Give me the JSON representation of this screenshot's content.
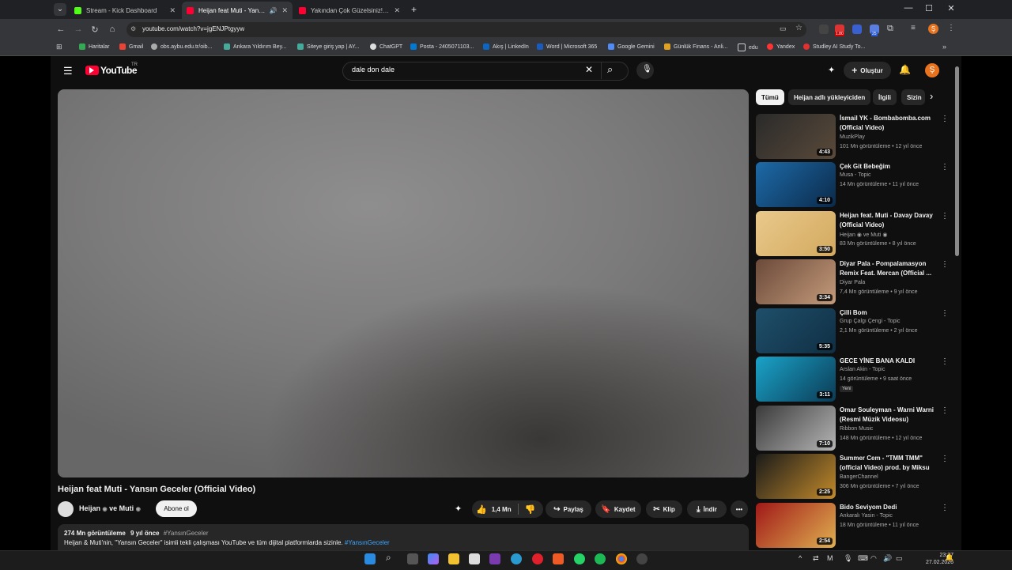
{
  "browser": {
    "tabs": [
      {
        "title": "Stream - Kick Dashboard",
        "color": "#53fc18"
      },
      {
        "title": "Heijan feat Muti - Yansın Ge",
        "color": "#ff0033"
      },
      {
        "title": "Yakından Çok Güzelsiniz! | Mar",
        "color": "#ff0033"
      }
    ],
    "new_tab": "+",
    "url": "youtube.com/watch?v=jgENJPtgyyw",
    "bookmarks": [
      "Haritalar",
      "Gmail",
      "obs.aybu.edu.tr/oib...",
      "Ankara Yıldırım Bey...",
      "Siteye giriş yap | AY...",
      "ChatGPT",
      "Posta - 2405071103...",
      "Akış | LinkedIn",
      "Word | Microsoft 365",
      "Google Gemini",
      "Günlük Finans - Anli...",
      "edu",
      "Yandex",
      "Studley AI Study To..."
    ],
    "badge": "1.80",
    "badge2": "25",
    "profile": "Ş"
  },
  "youtube": {
    "logo": "YouTube",
    "region": "TR",
    "search_value": "dale don dale",
    "create_label": "Oluştur",
    "avatar": "Ş",
    "video": {
      "title": "Heijan feat Muti - Yansın Geceler (Official Video)",
      "channel": "Heijan",
      "channel_and": "ve Muti",
      "subscribe": "Abone ol",
      "likes": "1,4 Mn",
      "share": "Paylaş",
      "save": "Kaydet",
      "clip": "Klip",
      "download": "İndir",
      "views": "274 Mn görüntüleme",
      "age": "9 yıl önce",
      "hashtag": "#YansınGeceler",
      "description": "Heijan & Muti'nin, \"Yansın Geceler\" isimli tekli çalışması YouTube ve tüm dijital platformlarda sizinle.",
      "description_tag": "#YansınGeceler"
    },
    "chips": [
      "Tümü",
      "Heijan adlı yükleyiciden",
      "İlgili",
      "Sizin"
    ],
    "recommendations": [
      {
        "title": "İsmail YK - Bombabomba.com (Official Video)",
        "channel": "MuzikPlay",
        "meta": "101 Mn görüntüleme • 12 yıl önce",
        "duration": "4:43",
        "colors": [
          "#2a2a2a",
          "#5a4a3a"
        ]
      },
      {
        "title": "Çek Git Bebeğim",
        "channel": "Musa - Topic",
        "meta": "14 Mn görüntüleme • 11 yıl önce",
        "duration": "4:10",
        "colors": [
          "#1d6aa8",
          "#0b2a4a"
        ]
      },
      {
        "title": "Heijan feat. Muti - Davay Davay (Official Video)",
        "channel": "Heijan",
        "channel_and": "ve Muti",
        "meta": "83 Mn görüntüleme • 8 yıl önce",
        "duration": "3:50",
        "colors": [
          "#e9c98c",
          "#d3a95e"
        ]
      },
      {
        "title": "Diyar Pala - Pompalamasyon Remix Feat. Mercan (Official ...",
        "channel": "Diyar Pala",
        "meta": "7,4 Mn görüntüleme • 9 yıl önce",
        "duration": "3:34",
        "colors": [
          "#6b4a3a",
          "#c49a7a"
        ]
      },
      {
        "title": "Çilli Bom",
        "channel": "Grup Çalgı Çengi - Topic",
        "meta": "2,1 Mn görüntüleme • 2 yıl önce",
        "duration": "5:35",
        "colors": [
          "#1f4f6a",
          "#0f2f44"
        ]
      },
      {
        "title": "GECE YİNE BANA KALDI",
        "channel": "Arslan Akin - Topic",
        "meta": "14 görüntüleme • 9 saat önce",
        "badge": "Yeni",
        "duration": "3:11",
        "colors": [
          "#1aa3c9",
          "#0b3b55"
        ]
      },
      {
        "title": "Omar Souleyman - Warni Warni (Resmi Müzik Videosu)",
        "channel": "Ribbon Music",
        "meta": "148 Mn görüntüleme • 12 yıl önce",
        "duration": "7:10",
        "colors": [
          "#3a3a3a",
          "#b5b5b5"
        ]
      },
      {
        "title": "Summer Cem - \"TMM TMM\" (official Video) prod. by Miksu",
        "channel": "BangerChannel",
        "meta": "306 Mn görüntüleme • 7 yıl önce",
        "duration": "2:25",
        "colors": [
          "#1a1a1a",
          "#c28a2a"
        ]
      },
      {
        "title": "Bido Seviyom Dedi",
        "channel": "Ankaralı Yasin - Topic",
        "meta": "18 Mn görüntüleme • 11 yıl önce",
        "duration": "2:54",
        "colors": [
          "#a01818",
          "#e0b050"
        ]
      }
    ]
  },
  "taskbar": {
    "time": "23:37",
    "date": "27.02.2026"
  }
}
